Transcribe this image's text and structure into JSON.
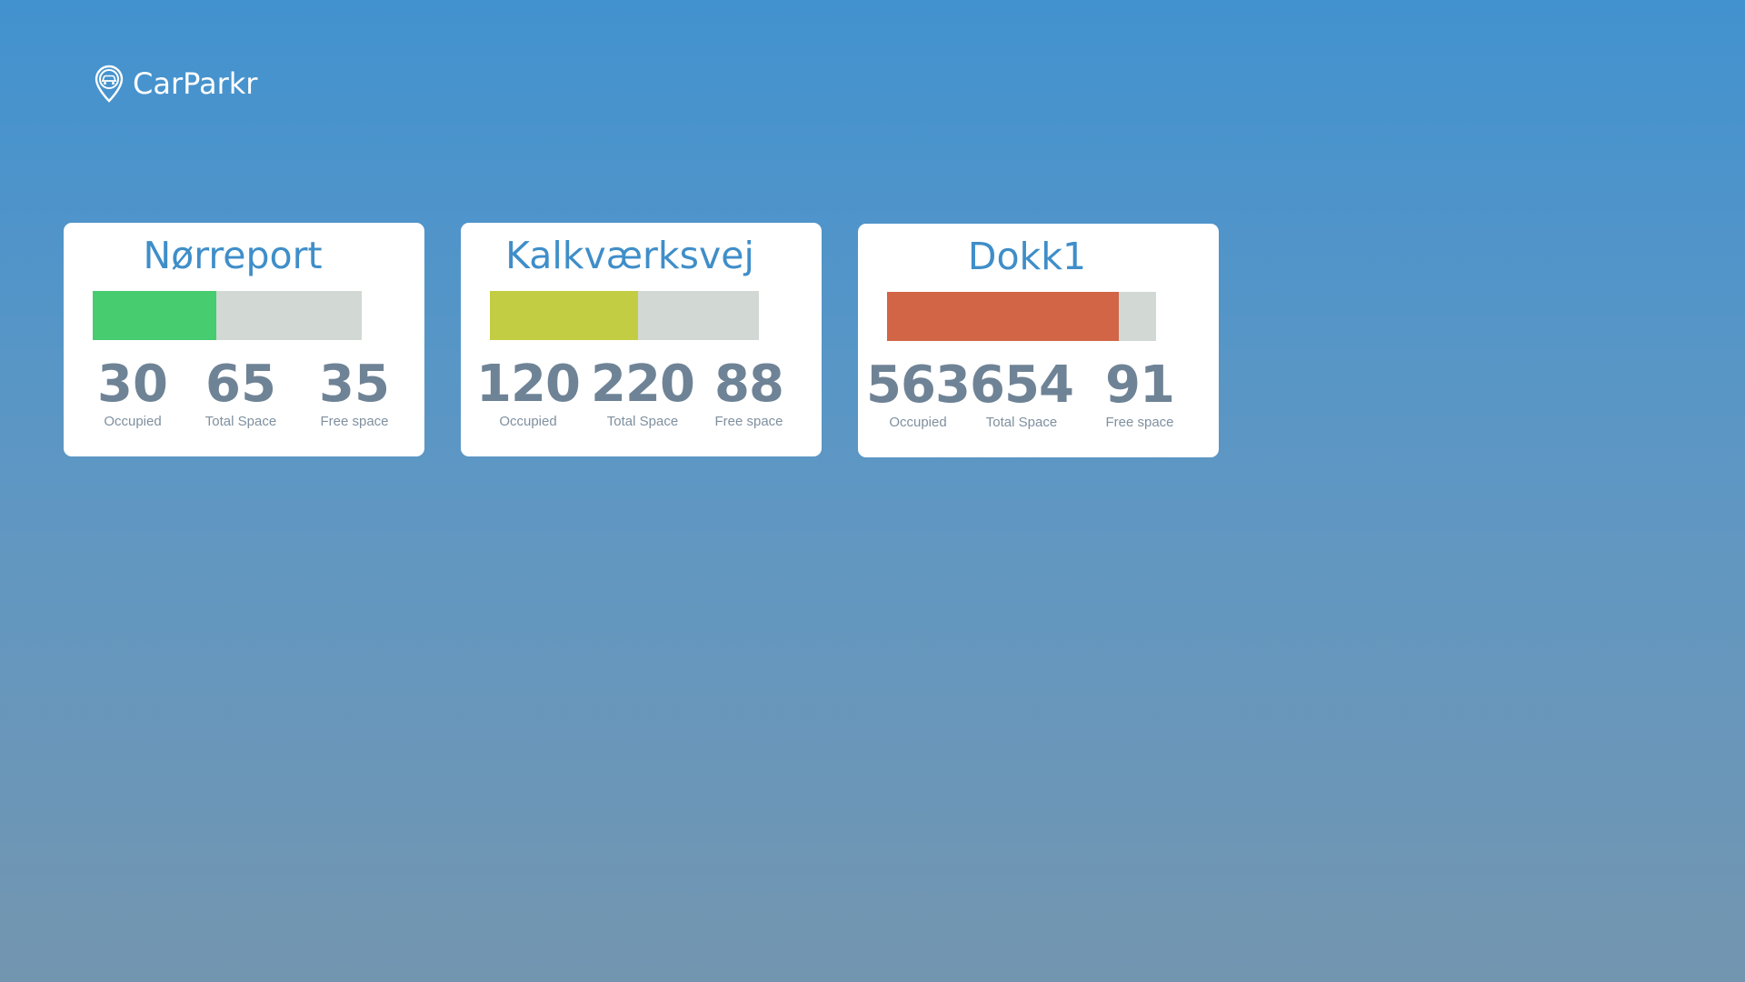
{
  "app": {
    "brand": "CarParkr",
    "logo_icon": "map-pin-car-icon"
  },
  "colors": {
    "background_top": "#4292cf",
    "background_bottom": "#7396b0",
    "title": "#3f8ec9",
    "number": "#6f8396",
    "bar_track": "#d2d8d4"
  },
  "parkings": [
    {
      "name": "Nørreport",
      "occupied": "30",
      "occupied_label": "Occupied",
      "total": "65",
      "total_label": "Total Space",
      "free": "35",
      "free_label": "Free space",
      "occupancy_fraction": 0.46,
      "bar_color": "#47cc6f"
    },
    {
      "name": "Kalkværksvej",
      "occupied": "120",
      "occupied_label": "Occupied",
      "total": "220",
      "total_label": "Total Space",
      "free": "88",
      "free_label": "Free space",
      "occupancy_fraction": 0.55,
      "bar_color": "#c3cd44"
    },
    {
      "name": "Dokk1",
      "occupied": "563",
      "occupied_label": "Occupied",
      "total": "654",
      "total_label": "Total Space",
      "free": "91",
      "free_label": "Free space",
      "occupancy_fraction": 0.86,
      "bar_color": "#d16546"
    }
  ]
}
